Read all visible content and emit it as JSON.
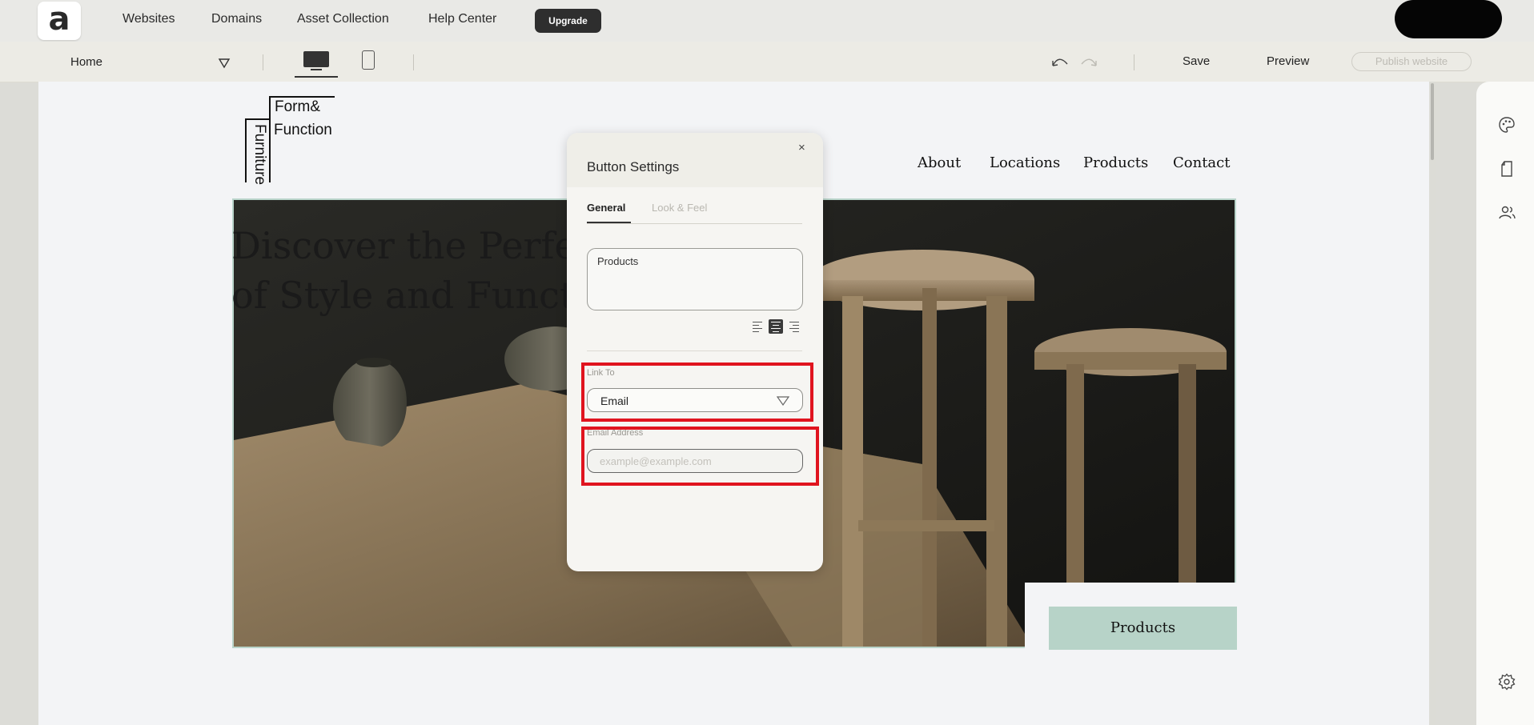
{
  "topbar": {
    "logo_letter": "a",
    "nav": [
      "Websites",
      "Domains",
      "Asset Collection",
      "Help Center"
    ],
    "upgrade_label": "Upgrade"
  },
  "toolbar": {
    "page_name": "Home",
    "save_label": "Save",
    "preview_label": "Preview",
    "publish_label": "Publish website"
  },
  "site": {
    "logo": {
      "line1": "Form&",
      "line2": "Function",
      "vertical": "Furniture"
    },
    "nav": [
      "About",
      "Locations",
      "Products",
      "Contact"
    ],
    "hero_line1": "Discover the Perfec",
    "hero_line2": "of Style and Functic",
    "cta_label": "Products"
  },
  "panel": {
    "title": "Button Settings",
    "close_glyph": "×",
    "tabs": [
      "General",
      "Look & Feel"
    ],
    "button_text": "Products",
    "link_to_label": "Link To",
    "link_to_value": "Email",
    "email_label": "Email Address",
    "email_placeholder": "example@example.com",
    "email_value": ""
  },
  "colors": {
    "highlight": "#e0141f",
    "cta": "#b7d3c8",
    "upgrade_bg": "#2e2e2e"
  },
  "icons": [
    "palette-icon",
    "page-icon",
    "users-icon",
    "settings-gear-icon",
    "undo-icon",
    "redo-icon",
    "desktop-icon",
    "mobile-icon",
    "chevron-down-icon",
    "close-icon",
    "align-left-icon",
    "align-center-icon",
    "align-right-icon"
  ]
}
